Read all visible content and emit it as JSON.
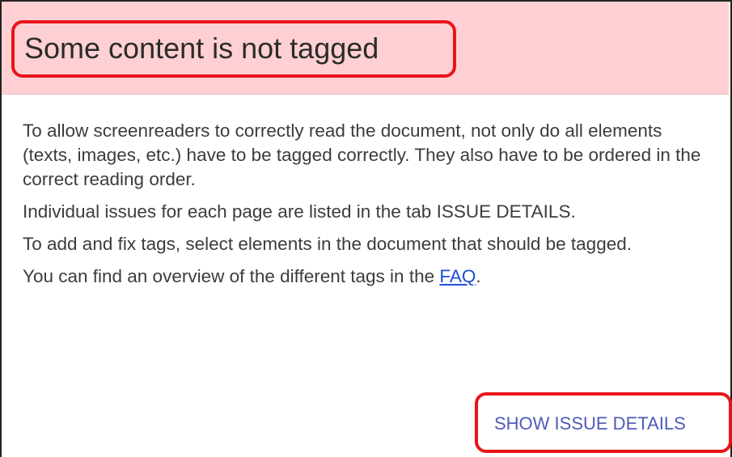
{
  "header": {
    "title": "Some content is not tagged"
  },
  "content": {
    "paragraph_1": "To allow screenreaders to correctly read the document, not only do all elements (texts, images, etc.) have to be tagged correctly. They also have to be ordered in the correct reading order.",
    "paragraph_2": "Individual issues for each page are listed in the tab ISSUE DETAILS.",
    "paragraph_3": "To add and fix tags, select elements in the document that should be tagged.",
    "paragraph_4_prefix": "You can find an overview of the different tags in the ",
    "faq_link": "FAQ",
    "paragraph_4_suffix": "."
  },
  "actions": {
    "show_issue_details": "SHOW ISSUE DETAILS"
  },
  "colors": {
    "header_background": "#ffd0d3",
    "highlight_outline": "#e8141a",
    "link": "#1d4fd8",
    "action_text": "#4f5bb8"
  }
}
